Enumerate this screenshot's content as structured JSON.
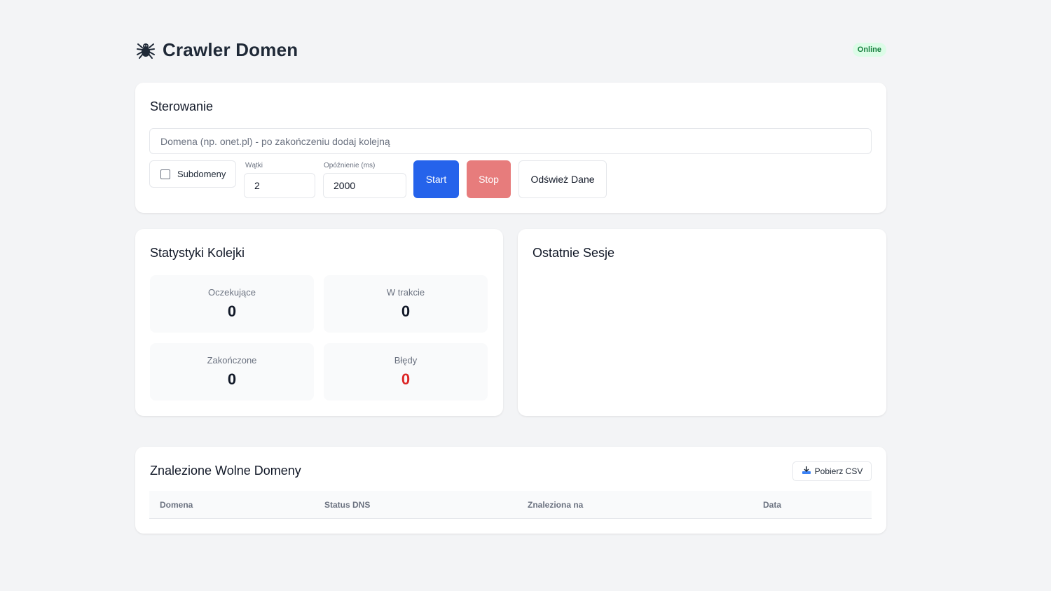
{
  "header": {
    "title": "Crawler Domen",
    "icon": "spider-icon",
    "status": "Online",
    "status_color": "#15803d"
  },
  "control": {
    "title": "Sterowanie",
    "domain_placeholder": "Domena (np. onet.pl) - po zakończeniu dodaj kolejną",
    "domain_value": "",
    "subdomains_label": "Subdomeny",
    "subdomains_checked": false,
    "threads_label": "Wątki",
    "threads_value": "2",
    "delay_label": "Opóźnienie (ms)",
    "delay_value": "2000",
    "start_label": "Start",
    "stop_label": "Stop",
    "refresh_label": "Odśwież Dane",
    "start_color": "#2563eb",
    "stop_color": "#e77c7c"
  },
  "stats": {
    "title": "Statystyki Kolejki",
    "items": [
      {
        "label": "Oczekujące",
        "value": "0"
      },
      {
        "label": "W trakcie",
        "value": "0"
      },
      {
        "label": "Zakończone",
        "value": "0"
      },
      {
        "label": "Błędy",
        "value": "0",
        "color": "#dc2626"
      }
    ]
  },
  "sessions": {
    "title": "Ostatnie Sesje",
    "items": []
  },
  "domains": {
    "title": "Znalezione Wolne Domeny",
    "csv_label": "Pobierz CSV",
    "csv_icon": "download-icon",
    "columns": [
      "Domena",
      "Status DNS",
      "Znaleziona na",
      "Data"
    ],
    "rows": []
  }
}
